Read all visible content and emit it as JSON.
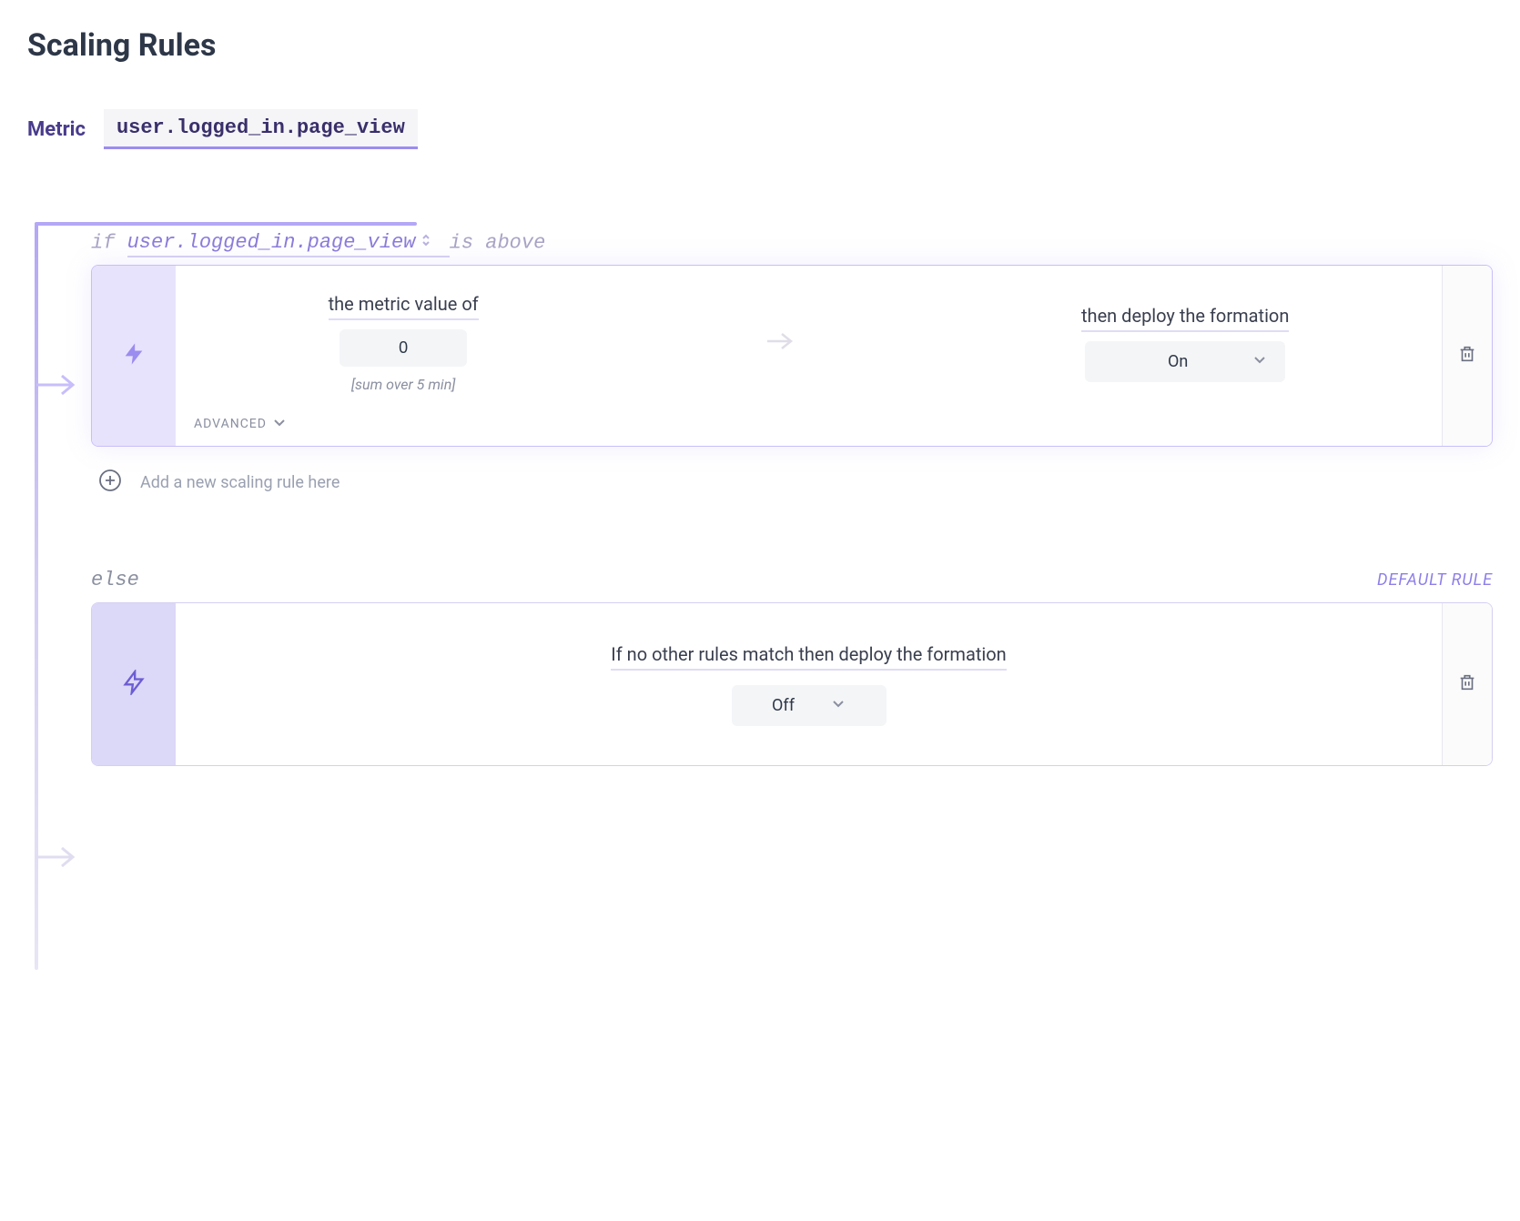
{
  "title": "Scaling Rules",
  "metric": {
    "label": "Metric",
    "value": "user.logged_in.page_view"
  },
  "rule": {
    "condition": {
      "if_keyword": "if",
      "metric_name": "user.logged_in.page_view",
      "comparison": "is above"
    },
    "metric_column": {
      "heading": "the metric value of",
      "value": "0",
      "aggregation": "[sum over 5 min]"
    },
    "formation_column": {
      "heading": "then deploy the formation",
      "selected": "On"
    },
    "advanced_label": "ADVANCED"
  },
  "add_rule": {
    "text": "Add a new scaling rule here"
  },
  "default_rule": {
    "else_keyword": "else",
    "badge": "DEFAULT RULE",
    "text": "If no other rules match then deploy the formation",
    "selected": "Off"
  }
}
